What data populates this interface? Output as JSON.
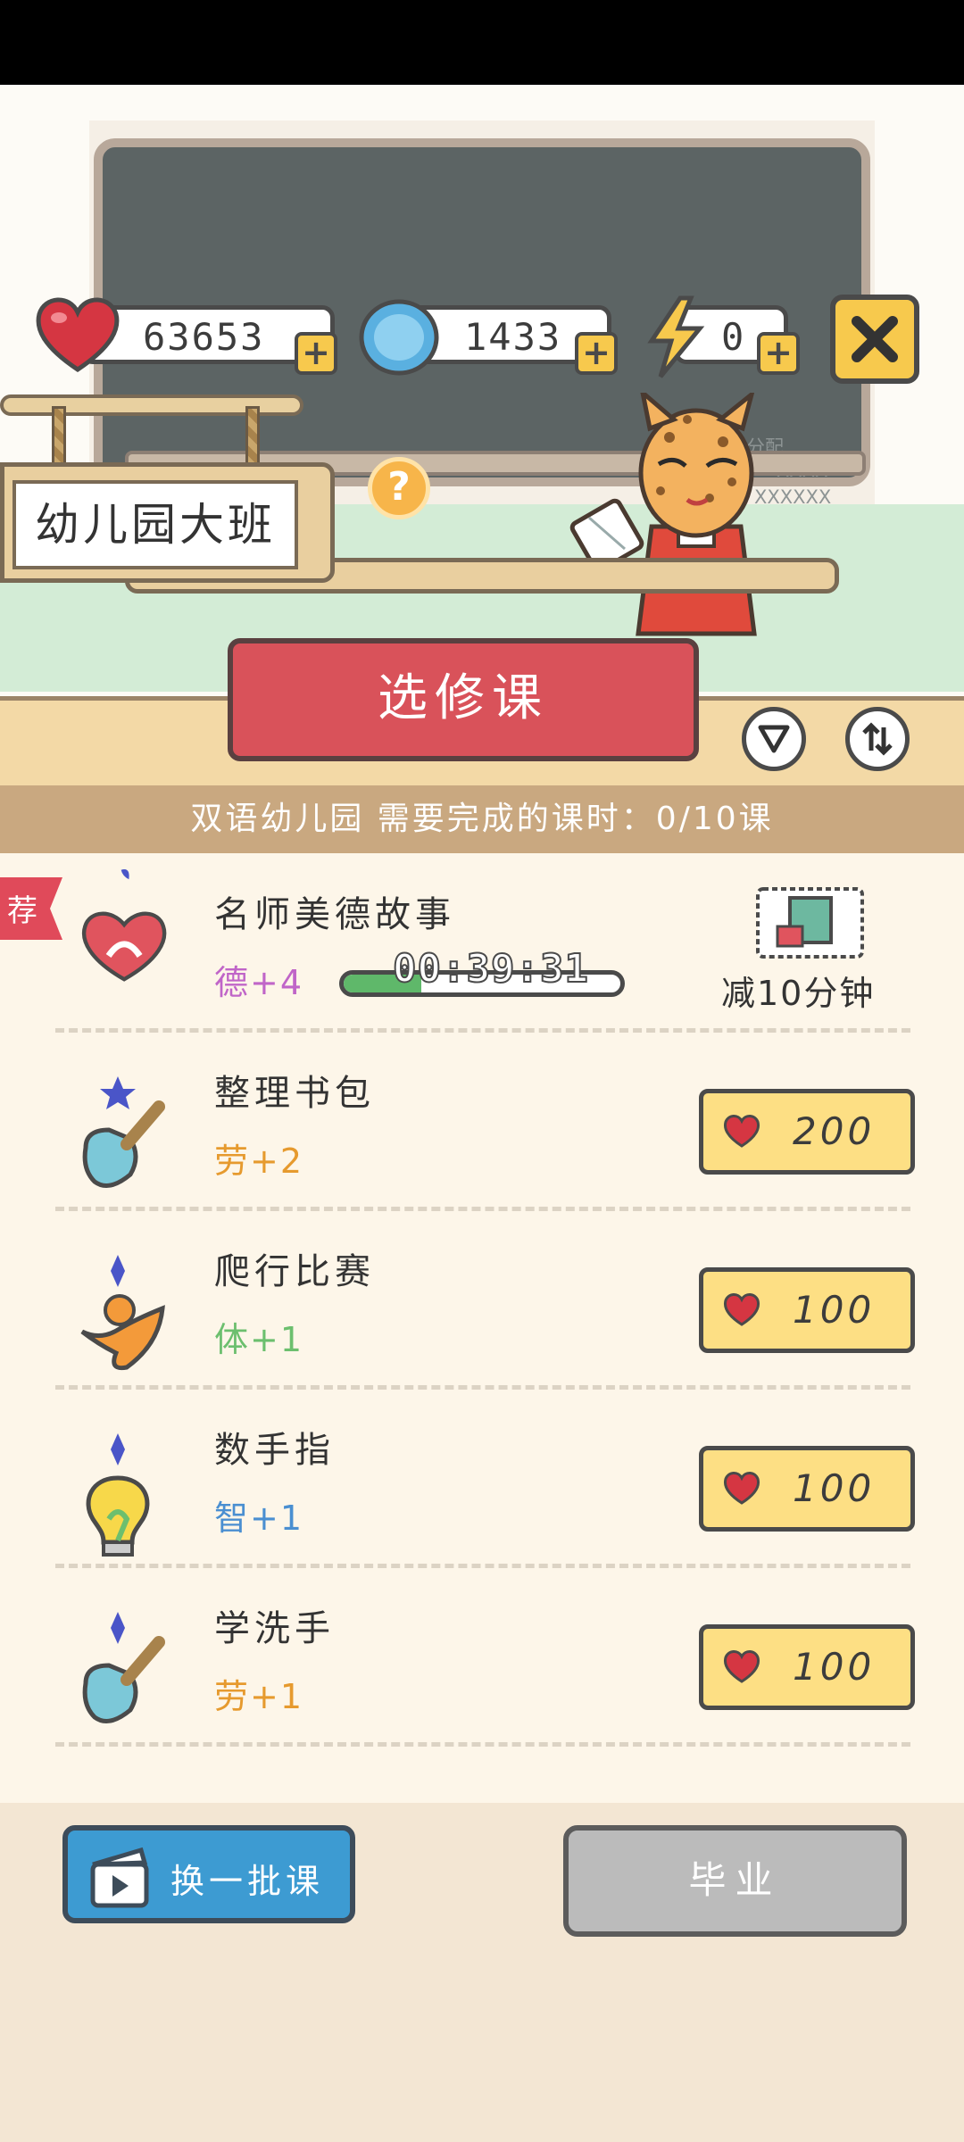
{
  "resources": {
    "hearts": "63653",
    "coins": "1433",
    "energy": "0"
  },
  "class_sign": "幼儿园大班",
  "board_text": [
    "日分配",
    "XXXX",
    "XXXXXX"
  ],
  "title": "选修课",
  "info_band": "双语幼儿园  需要完成的课时：0/10课",
  "recommended_tag": "荐",
  "featured_course": {
    "name": "名师美德故事",
    "stat": "德+4",
    "stat_color": "#c065c8",
    "timer": "00:39:31",
    "progress": 0.28,
    "reward_label": "减10分钟"
  },
  "courses": [
    {
      "name": "整理书包",
      "stat": "劳+2",
      "stat_color": "#e69a2e",
      "price": "200",
      "icon": "shovel-icon",
      "badge": "star"
    },
    {
      "name": "爬行比赛",
      "stat": "体+1",
      "stat_color": "#6cbf6e",
      "price": "100",
      "icon": "running-figure-icon",
      "badge": "diamond"
    },
    {
      "name": "数手指",
      "stat": "智+1",
      "stat_color": "#4a8fd1",
      "price": "100",
      "icon": "lightbulb-icon",
      "badge": "diamond"
    },
    {
      "name": "学洗手",
      "stat": "劳+1",
      "stat_color": "#e69a2e",
      "price": "100",
      "icon": "shovel-icon",
      "badge": "diamond"
    }
  ],
  "buttons": {
    "refresh": "换一批课",
    "graduate": "毕业"
  }
}
